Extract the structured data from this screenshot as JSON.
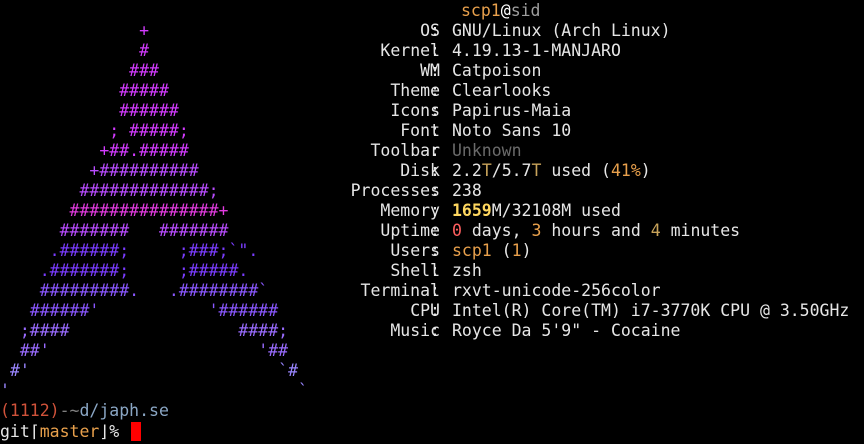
{
  "logo": [
    [
      {
        "t": "              ",
        "c": "c0"
      },
      {
        "t": "+",
        "c": "c6"
      }
    ],
    [
      {
        "t": "              ",
        "c": "c0"
      },
      {
        "t": "#",
        "c": "c6"
      }
    ],
    [
      {
        "t": "             ",
        "c": "c0"
      },
      {
        "t": "###",
        "c": "c6"
      }
    ],
    [
      {
        "t": "            ",
        "c": "c0"
      },
      {
        "t": "#####",
        "c": "c6"
      }
    ],
    [
      {
        "t": "            ",
        "c": "c0"
      },
      {
        "t": "######",
        "c": "c6"
      }
    ],
    [
      {
        "t": "           ",
        "c": "c0"
      },
      {
        "t": "; #####;",
        "c": "c6"
      }
    ],
    [
      {
        "t": "          ",
        "c": "c0"
      },
      {
        "t": "+##.#####",
        "c": "c6"
      }
    ],
    [
      {
        "t": "         ",
        "c": "c0"
      },
      {
        "t": "+##########",
        "c": "c5"
      }
    ],
    [
      {
        "t": "        ",
        "c": "c0"
      },
      {
        "t": "#############;",
        "c": "c5"
      }
    ],
    [
      {
        "t": "       ",
        "c": "c0"
      },
      {
        "t": "###############+",
        "c": "c7"
      }
    ],
    [
      {
        "t": "      ",
        "c": "c0"
      },
      {
        "t": "#######   #######",
        "c": "c5"
      }
    ],
    [
      {
        "t": "     ",
        "c": "c0"
      },
      {
        "t": ".######;     ;###;`\".",
        "c": "c4"
      }
    ],
    [
      {
        "t": "    ",
        "c": "c0"
      },
      {
        "t": ".#######;     ;#####.",
        "c": "c4"
      }
    ],
    [
      {
        "t": "    ",
        "c": "c0"
      },
      {
        "t": "#########.   .########`",
        "c": "c3"
      }
    ],
    [
      {
        "t": "   ",
        "c": "c0"
      },
      {
        "t": "######'           '######",
        "c": "c3"
      }
    ],
    [
      {
        "t": "  ",
        "c": "c0"
      },
      {
        "t": ";####                 ####;",
        "c": "c2"
      }
    ],
    [
      {
        "t": "  ",
        "c": "c0"
      },
      {
        "t": "##'                     '##",
        "c": "c2"
      }
    ],
    [
      {
        "t": " ",
        "c": "c0"
      },
      {
        "t": "#'                         `#",
        "c": "c1"
      }
    ],
    [
      {
        "t": "",
        "c": "c0"
      },
      {
        "t": "'                             `",
        "c": "c1"
      }
    ]
  ],
  "header": {
    "user": "scp1",
    "at": "@",
    "host": "sid"
  },
  "info": [
    {
      "label": "OS",
      "value": "GNU/Linux (Arch Linux)"
    },
    {
      "label": "Kernel",
      "value": "4.19.13-1-MANJARO"
    },
    {
      "label": "WM",
      "value": "Catpoison"
    },
    {
      "label": "Theme",
      "value": "Clearlooks"
    },
    {
      "label": "Icons",
      "value": "Papirus-Maia"
    },
    {
      "label": "Font",
      "value": "Noto Sans 10"
    },
    {
      "label": "Toolbar",
      "value": "Unknown"
    },
    {
      "label": "Disk",
      "value": "2.2T/5.7T used (41%)"
    },
    {
      "label": "Processes",
      "value": "238"
    },
    {
      "label": "Memory",
      "value": "1659M/32108M used"
    },
    {
      "label": "Uptime",
      "value": "0 days, 3 hours and 4 minutes"
    },
    {
      "label": "Users",
      "value": "scp1 (1)"
    },
    {
      "label": "Shell",
      "value": "zsh"
    },
    {
      "label": "Terminal",
      "value": "rxvt-unicode-256color"
    },
    {
      "label": "CPU",
      "value": "Intel(R) Core(TM) i7-3770K CPU @ 3.50GHz"
    },
    {
      "label": "Music",
      "value": "Royce Da 5'9\" - Cocaine"
    }
  ],
  "info_parts": {
    "disk": {
      "used": "2.2",
      "used_unit": "T",
      "sep": "/",
      "total": "5.7",
      "total_unit": "T",
      "suffix": " used (",
      "pct": "41%",
      "close": ")"
    },
    "memory": {
      "used": "1659",
      "rest": "M/32108M used"
    },
    "uptime": {
      "days": "0",
      "days_label": " days, ",
      "hours": "3",
      "hours_label": " hours and ",
      "minutes": "4",
      "minutes_label": " minutes"
    },
    "users": {
      "name": "scp1",
      "open": " (",
      "count": "1",
      "close": ")"
    }
  },
  "prompt": {
    "line1_count": "(1112)",
    "line1_dash": "-",
    "line1_tilde": "~",
    "line1_path": "d/japh.se",
    "git_label": "git",
    "bracket_open": "⌈",
    "branch": "master",
    "bracket_close": "⌋",
    "symbol": "%"
  },
  "colors": {
    "background": "#000000",
    "text": "#e6e6e6",
    "accent_orange": "#e8a04c",
    "memory_yellow": "#ffd75f",
    "uptime_red": "#ff5f5f",
    "cursor": "#ff0000"
  }
}
